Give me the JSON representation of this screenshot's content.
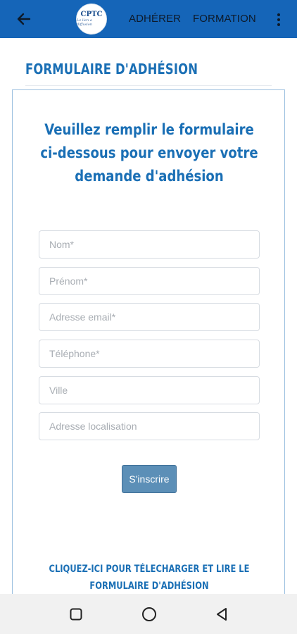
{
  "topbar": {
    "logo_text": "CPTC",
    "logo_subtext": "Le lien a diffusion",
    "nav": [
      "ADHÉRER",
      "FORMATION"
    ]
  },
  "page": {
    "title": "FORMULAIRE D'ADHÉSION"
  },
  "form": {
    "heading_lines": [
      "Veuillez remplir le formulaire",
      "ci-dessous pour envoyer votre",
      "demande d'adhésion"
    ],
    "fields": [
      {
        "name": "nom",
        "placeholder": "Nom*",
        "value": ""
      },
      {
        "name": "prenom",
        "placeholder": "Prénom*",
        "value": ""
      },
      {
        "name": "email",
        "placeholder": "Adresse email*",
        "value": ""
      },
      {
        "name": "telephone",
        "placeholder": "Téléphone*",
        "value": ""
      },
      {
        "name": "ville",
        "placeholder": "Ville",
        "value": ""
      },
      {
        "name": "adresse",
        "placeholder": "Adresse localisation",
        "value": ""
      }
    ],
    "submit_label": "S'inscrire",
    "download_link_lines": [
      "CLIQUEZ-ICI POUR TÉLECHARGER ET LIRE LE",
      "FORMULAIRE D'ADHÉSION"
    ]
  },
  "colors": {
    "topbar": "#1565b8",
    "accent": "#1a6fb5",
    "button": "#5c8fb7"
  },
  "icons": {
    "back": "arrow-left-icon",
    "more": "more-vertical-icon",
    "system_recents": "square-icon",
    "system_home": "circle-icon",
    "system_back": "triangle-icon"
  }
}
